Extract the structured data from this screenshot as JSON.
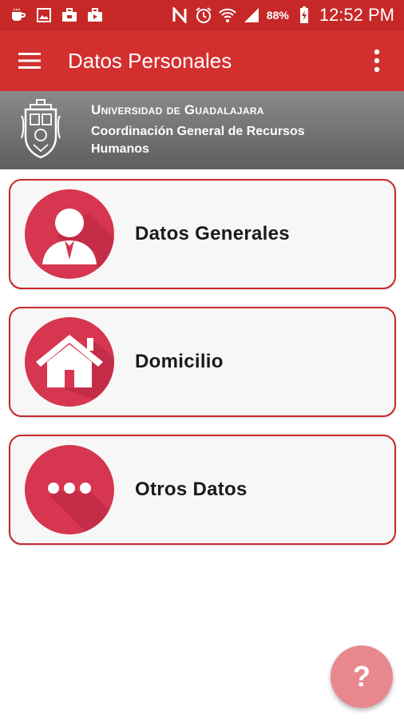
{
  "status_bar": {
    "battery": "88%",
    "time": "12:52 PM",
    "icons_left": [
      "coffee-icon",
      "gallery-icon",
      "briefcase-icon",
      "briefcase-play-icon"
    ],
    "icons_right": [
      "nfc-icon",
      "alarm-icon",
      "wifi-icon",
      "signal-icon",
      "battery-icon"
    ]
  },
  "app_bar": {
    "title": "Datos Personales",
    "menu_icon": "hamburger-menu-icon",
    "more_icon": "more-vert-icon"
  },
  "banner": {
    "university": "Universidad de Guadalajara",
    "department": "Coordinación General de Recursos Humanos",
    "logo": "university-crest-logo"
  },
  "cards": [
    {
      "label": "Datos Generales",
      "icon": "person-icon"
    },
    {
      "label": "Domicilio",
      "icon": "house-icon"
    },
    {
      "label": "Otros Datos",
      "icon": "ellipsis-icon"
    }
  ],
  "fab": {
    "label": "?",
    "icon": "help-icon"
  },
  "colors": {
    "status_bar": "#c62828",
    "app_bar": "#d32f2f",
    "accent": "#d63650",
    "card_border": "#c62828",
    "fab": "#e8888e"
  }
}
